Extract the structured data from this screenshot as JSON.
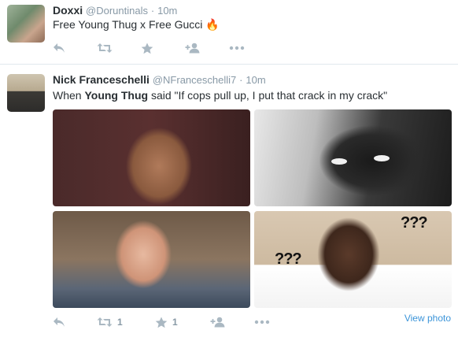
{
  "tweets": [
    {
      "name": "Doxxi",
      "handle": "@Doruntinals",
      "separator": "·",
      "time": "10m",
      "text": "Free Young Thug x Free Gucci",
      "emoji": "🔥",
      "actions": {
        "reply_icon": "reply-icon",
        "retweet_icon": "retweet-icon",
        "favorite_icon": "star-icon",
        "follow_icon": "follow-icon",
        "more_icon": "more-icon",
        "retweet_count": "",
        "favorite_count": ""
      }
    },
    {
      "name": "Nick Franceschelli",
      "handle": "@NFranceschelli7",
      "separator": "·",
      "time": "10m",
      "text_before": "When ",
      "text_bold": "Young Thug",
      "text_after": " said \"If cops pull up, I put that crack in my crack\"",
      "photos": [
        {
          "label": "",
          "overlay": ""
        },
        {
          "label": "",
          "overlay": ""
        },
        {
          "label": "",
          "overlay": ""
        },
        {
          "label": "",
          "overlay_1": "???",
          "overlay_2": "???"
        }
      ],
      "actions": {
        "retweet_count": "1",
        "favorite_count": "1"
      },
      "view_photo": "View photo"
    }
  ],
  "colors": {
    "name": "#292f33",
    "meta": "#8899a6",
    "action": "#aab8c2",
    "link": "#3b94d9",
    "divider": "#e1e8ed"
  }
}
